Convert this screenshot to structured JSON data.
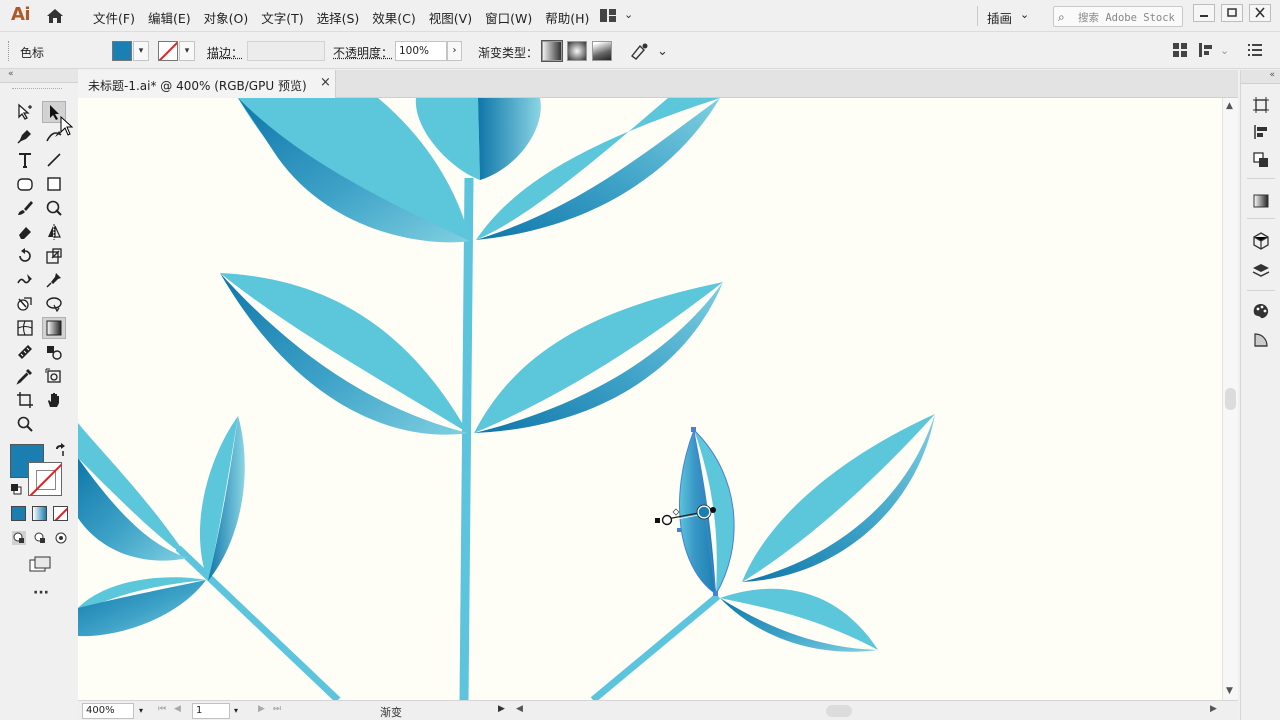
{
  "app": {
    "logo": "Ai",
    "menus": [
      "文件(F)",
      "编辑(E)",
      "对象(O)",
      "文字(T)",
      "选择(S)",
      "效果(C)",
      "视图(V)",
      "窗口(W)",
      "帮助(H)"
    ],
    "workspace": "插画",
    "stock_placeholder": "搜索 Adobe Stock"
  },
  "control": {
    "selection_label": "色标",
    "stroke_label": "描边：",
    "opacity_label": "不透明度：",
    "opacity_value": "100%",
    "gradient_type_label": "渐变类型："
  },
  "document": {
    "tab_title": "未标题-1.ai* @ 400% (RGB/GPU 预览)",
    "close_glyph": "×"
  },
  "status": {
    "zoom": "400%",
    "page": "1",
    "tool_name": "渐变"
  },
  "colors": {
    "fill": "#1b7eb1",
    "leaf_light": "#5cc6da",
    "leaf_dark": "#127fb0",
    "stem": "#5cc4dc",
    "canvas_bg": "#fefdf6",
    "stroke_none": "#e02020"
  },
  "toolbar_tools": [
    "direct-selection-tool-icon",
    "selection-tool-icon",
    "pen-tool-icon",
    "curvature-tool-icon",
    "type-tool-icon",
    "line-tool-icon",
    "ellipse-tool-icon",
    "rectangle-tool-icon",
    "paintbrush-tool-icon",
    "blob-brush-tool-icon",
    "eraser-tool-icon",
    "reflect-tool-icon",
    "rotate-tool-icon",
    "scale-tool-icon",
    "warp-tool-icon",
    "puppet-warp-tool-icon",
    "shape-builder-tool-icon",
    "live-paint-tool-icon",
    "mesh-tool-icon",
    "gradient-tool-icon",
    "eyedropper-measure-icon",
    "symbol-sprayer-icon",
    "eyedropper-tool-icon",
    "artboard-snapshot-icon",
    "artboard-tool-icon",
    "hand-tool-icon",
    "zoom-tool-icon"
  ]
}
